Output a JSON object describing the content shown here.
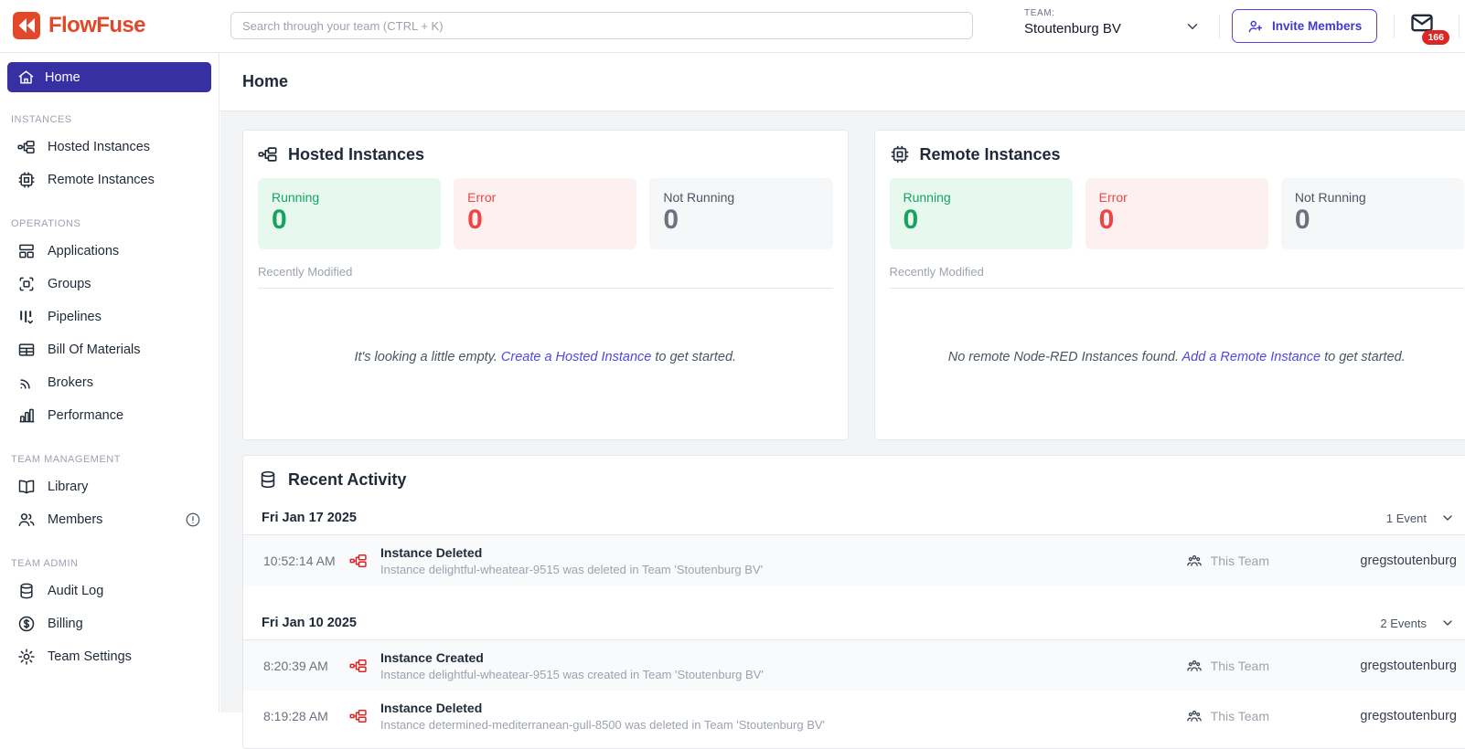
{
  "colors": {
    "brand": "#E2472A",
    "nav_active_bg": "#3730A3",
    "link": "#4F46E5",
    "running_green": "#17A35F",
    "error_red": "#EF4444",
    "idle_gray": "#6B7280",
    "badge_red": "#DC2626",
    "event_icon_red": "#DC2626"
  },
  "topbar": {
    "brand_name": "FlowFuse",
    "search_placeholder": "Search through your team (CTRL + K)",
    "team_label": "TEAM:",
    "team_name": "Stoutenburg BV",
    "invite_button_label": "Invite Members",
    "notification_count": "166",
    "icons": {
      "brand": "flowfuse-logo",
      "team_chevron": "chevron-down-icon",
      "invite": "user-plus-icon",
      "notifications": "mail-icon"
    }
  },
  "sidebar": {
    "home": {
      "label": "Home",
      "icon": "home-icon"
    },
    "sections": [
      {
        "label": "INSTANCES",
        "items": [
          {
            "label": "Hosted Instances",
            "icon": "hosted-instances-icon"
          },
          {
            "label": "Remote Instances",
            "icon": "chip-icon"
          }
        ]
      },
      {
        "label": "OPERATIONS",
        "items": [
          {
            "label": "Applications",
            "icon": "applications-icon"
          },
          {
            "label": "Groups",
            "icon": "groups-icon"
          },
          {
            "label": "Pipelines",
            "icon": "pipelines-icon"
          },
          {
            "label": "Bill Of Materials",
            "icon": "table-icon"
          },
          {
            "label": "Brokers",
            "icon": "signal-icon"
          },
          {
            "label": "Performance",
            "icon": "bar-chart-icon"
          }
        ]
      },
      {
        "label": "TEAM MANAGEMENT",
        "items": [
          {
            "label": "Library",
            "icon": "book-icon"
          },
          {
            "label": "Members",
            "icon": "users-icon",
            "badge_icon": "alert-circle-icon"
          }
        ]
      },
      {
        "label": "TEAM ADMIN",
        "items": [
          {
            "label": "Audit Log",
            "icon": "database-icon"
          },
          {
            "label": "Billing",
            "icon": "dollar-circle-icon"
          },
          {
            "label": "Team Settings",
            "icon": "gear-icon"
          }
        ]
      }
    ]
  },
  "main": {
    "page_title": "Home",
    "hosted_card": {
      "title": "Hosted Instances",
      "icon": "hosted-instances-icon",
      "stats": [
        {
          "label": "Running",
          "value": "0",
          "status": "running"
        },
        {
          "label": "Error",
          "value": "0",
          "status": "error"
        },
        {
          "label": "Not Running",
          "value": "0",
          "status": "idle"
        }
      ],
      "recently_modified_label": "Recently Modified",
      "empty_prefix": "It's looking a little empty. ",
      "empty_link": "Create a Hosted Instance",
      "empty_suffix": " to get started."
    },
    "remote_card": {
      "title": "Remote Instances",
      "icon": "chip-icon",
      "stats": [
        {
          "label": "Running",
          "value": "0",
          "status": "running"
        },
        {
          "label": "Error",
          "value": "0",
          "status": "error"
        },
        {
          "label": "Not Running",
          "value": "0",
          "status": "idle"
        }
      ],
      "recently_modified_label": "Recently Modified",
      "empty_prefix": "No remote Node-RED Instances found. ",
      "empty_link": "Add a Remote Instance",
      "empty_suffix": " to get started."
    },
    "activity": {
      "title": "Recent Activity",
      "icon": "database-icon",
      "groups": [
        {
          "date": "Fri Jan 17 2025",
          "count_label": "1 Event",
          "events": [
            {
              "time": "10:52:14 AM",
              "title": "Instance Deleted",
              "description": "Instance delightful-wheatear-9515 was deleted in Team 'Stoutenburg BV'",
              "scope": "This Team",
              "user": "gregstoutenburg"
            }
          ]
        },
        {
          "date": "Fri Jan 10 2025",
          "count_label": "2 Events",
          "events": [
            {
              "time": "8:20:39 AM",
              "title": "Instance Created",
              "description": "Instance delightful-wheatear-9515 was created in Team 'Stoutenburg BV'",
              "scope": "This Team",
              "user": "gregstoutenburg"
            },
            {
              "time": "8:19:28 AM",
              "title": "Instance Deleted",
              "description": "Instance determined-mediterranean-gull-8500 was deleted in Team 'Stoutenburg BV'",
              "scope": "This Team",
              "user": "gregstoutenburg"
            }
          ]
        }
      ]
    }
  }
}
